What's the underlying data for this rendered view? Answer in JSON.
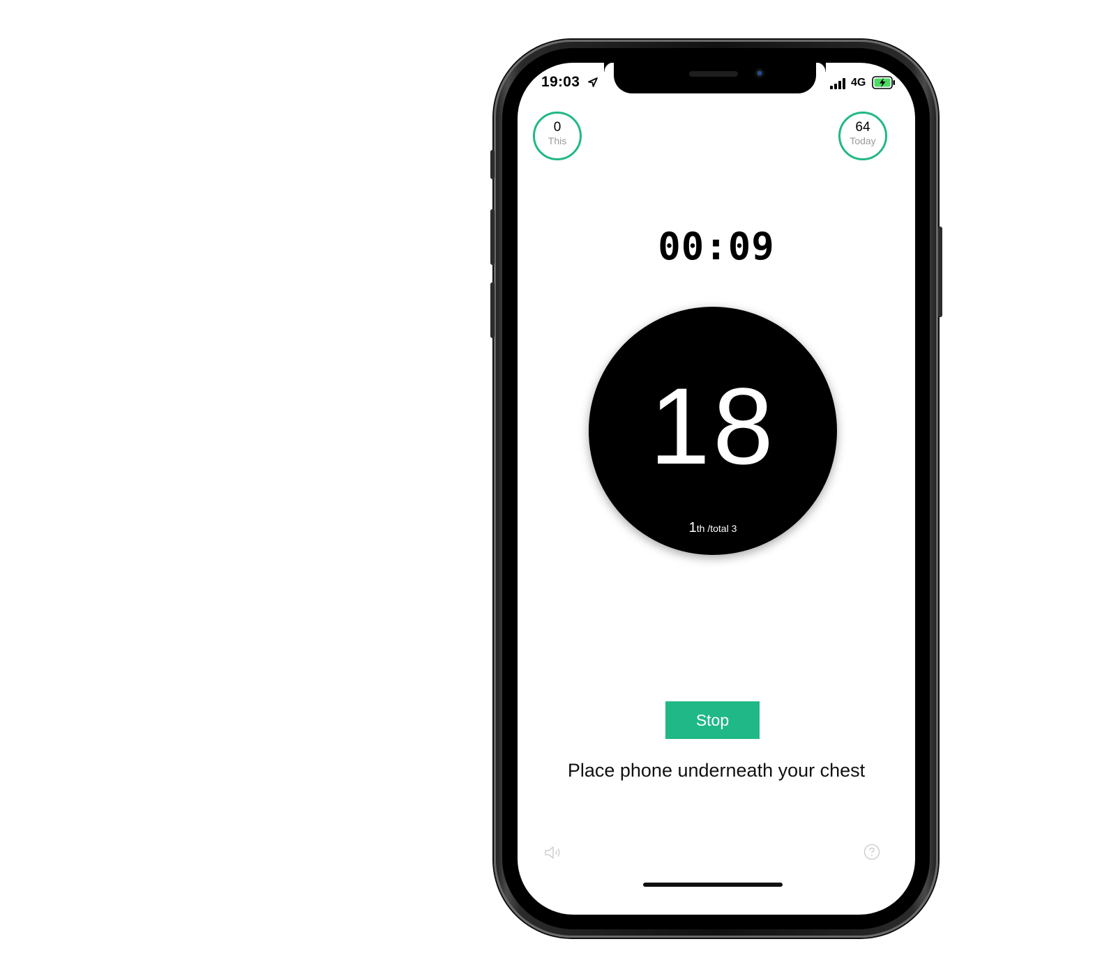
{
  "status_bar": {
    "time": "19:03",
    "network": "4G",
    "location_icon": "location-arrow-icon",
    "signal_icon": "cellular-signal-icon",
    "battery_icon": "battery-charging-icon"
  },
  "counters": {
    "this": {
      "value": "0",
      "label": "This"
    },
    "today": {
      "value": "64",
      "label": "Today"
    }
  },
  "timer": "00:09",
  "breath": {
    "count": "18",
    "round": "1",
    "round_suffix": "th /total 3"
  },
  "stop_label": "Stop",
  "hint": "Place phone underneath your chest",
  "bottom_icons": {
    "sound": "speaker-icon",
    "help": "question-circle-icon"
  },
  "colors": {
    "accent": "#20b887",
    "circle": "#000000",
    "battery": "#4cd964"
  }
}
